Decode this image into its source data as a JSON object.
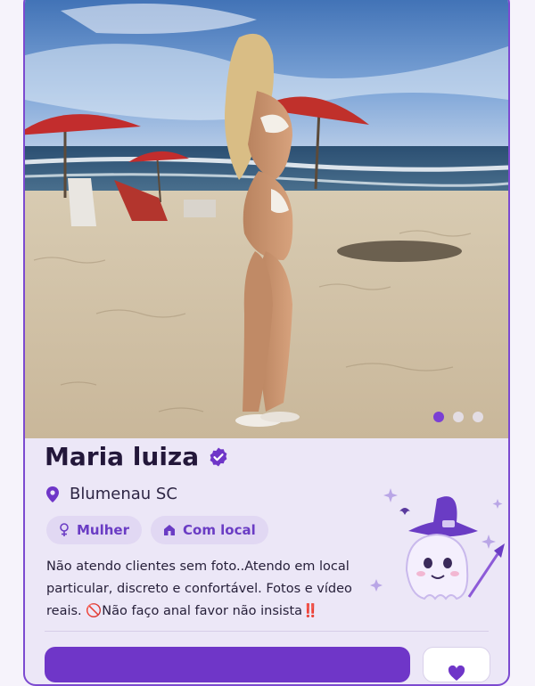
{
  "profile": {
    "name": "Maria luiza",
    "location": "Blumenau SC",
    "tags": [
      "Mulher",
      "Com local"
    ],
    "description": "Não atendo clientes sem foto..Atendo em local particular, discreto e confortável. Fotos e vídeo reais. 🚫Não faço anal favor não insista‼️",
    "verified": true
  },
  "carousel": {
    "current": 1,
    "total": 3
  },
  "icons": {
    "verified": "verified-check-icon",
    "location": "map-pin-icon",
    "gender": "female-symbol-icon",
    "place": "house-icon",
    "favorite": "heart-icon"
  },
  "colors": {
    "accent": "#6f36c8",
    "card_bg": "#ece7f7",
    "tag_bg": "#e1d8f3"
  }
}
